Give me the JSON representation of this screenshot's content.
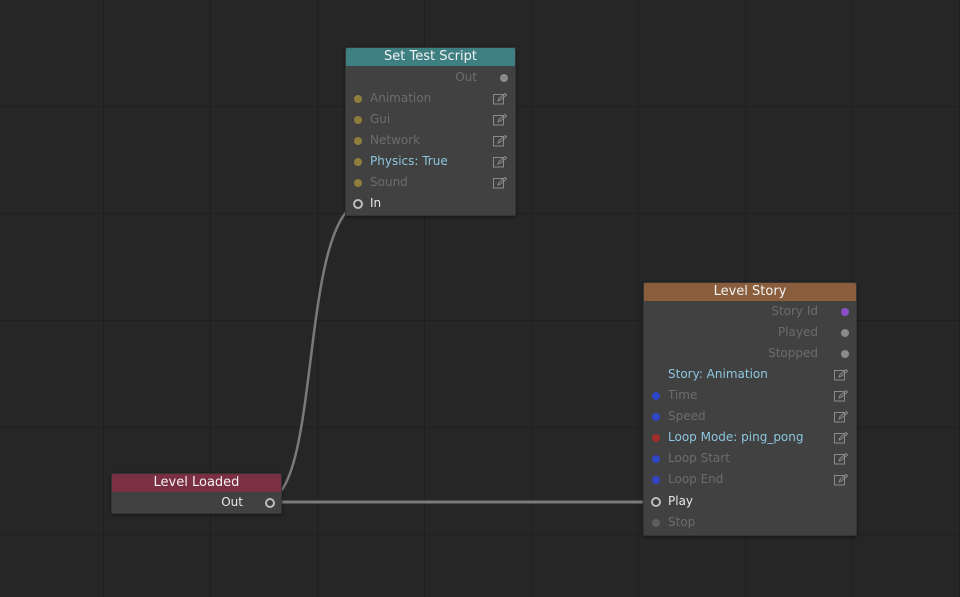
{
  "colors": {
    "canvas": "#262626",
    "wire": "#7a7a7a",
    "set_test_script_header": "#3e7f82",
    "level_loaded_header": "#7b2f43",
    "level_story_header": "#8a5d3c",
    "port_yellow": "#8f7d3c",
    "port_gray": "#8a8a8a",
    "port_purple": "#8a4fc7",
    "port_blue": "#2f45c8",
    "port_red": "#a02c2c"
  },
  "nodes": {
    "set_test_script": {
      "title": "Set Test Script",
      "outputs": {
        "out": "Out"
      },
      "inputs": [
        {
          "label": "Animation",
          "icon": "edit-icon"
        },
        {
          "label": "Gui",
          "icon": "edit-icon"
        },
        {
          "label": "Network",
          "icon": "edit-icon"
        },
        {
          "label": "Physics: True",
          "icon": "edit-icon"
        },
        {
          "label": "Sound",
          "icon": "edit-icon"
        }
      ],
      "trigger": "In"
    },
    "level_loaded": {
      "title": "Level Loaded",
      "outputs": {
        "out": "Out"
      }
    },
    "level_story": {
      "title": "Level Story",
      "outputs": [
        "Story Id",
        "Played",
        "Stopped"
      ],
      "inputs": [
        {
          "label": "Story: Animation",
          "icon": "edit-icon"
        },
        {
          "label": "Time",
          "icon": "edit-icon"
        },
        {
          "label": "Speed",
          "icon": "edit-icon"
        },
        {
          "label": "Loop Mode: ping_pong",
          "icon": "edit-icon"
        },
        {
          "label": "Loop Start",
          "icon": "edit-icon"
        },
        {
          "label": "Loop End",
          "icon": "edit-icon"
        }
      ],
      "triggers": [
        "Play",
        "Stop"
      ]
    }
  },
  "connections": [
    {
      "from": "Level Loaded.Out",
      "to": "Set Test Script.In"
    },
    {
      "from": "Level Loaded.Out",
      "to": "Level Story.Play"
    }
  ]
}
